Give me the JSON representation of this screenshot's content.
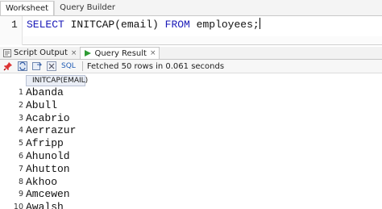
{
  "top_tabs": [
    "Worksheet",
    "Query Builder"
  ],
  "editor": {
    "line_number": "1",
    "tokens": [
      {
        "text": "SELECT",
        "kind": "kw"
      },
      {
        "text": " INITCAP(email) ",
        "kind": "plain"
      },
      {
        "text": "FROM",
        "kind": "kw"
      },
      {
        "text": " employees;",
        "kind": "plain"
      }
    ]
  },
  "result_tabs": {
    "script_output": "Script Output",
    "query_result": "Query Result",
    "close_glyph": "×"
  },
  "toolbar": {
    "sql_label": "SQL",
    "separator": "|",
    "status": "Fetched 50 rows in 0.061 seconds"
  },
  "grid": {
    "column_header": "INITCAP(EMAIL)",
    "rows": [
      {
        "num": "1",
        "value": "Abanda"
      },
      {
        "num": "2",
        "value": "Abull"
      },
      {
        "num": "3",
        "value": "Acabrio"
      },
      {
        "num": "4",
        "value": "Aerrazur"
      },
      {
        "num": "5",
        "value": "Afripp"
      },
      {
        "num": "6",
        "value": "Ahunold"
      },
      {
        "num": "7",
        "value": "Ahutton"
      },
      {
        "num": "8",
        "value": "Akhoo"
      },
      {
        "num": "9",
        "value": "Amcewen"
      },
      {
        "num": "10",
        "value": "Awalsh"
      }
    ]
  },
  "colors": {
    "keyword": "#1a1ab8",
    "sql_label": "#1f5bb5",
    "header_bg": "#eaeef6"
  }
}
